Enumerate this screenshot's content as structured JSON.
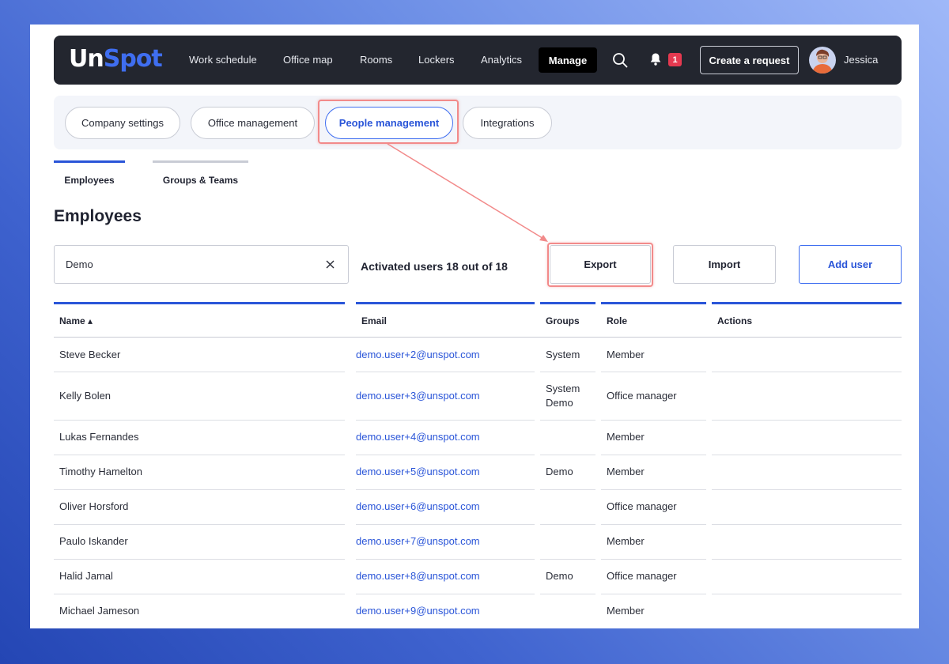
{
  "brand": {
    "logo_un": "Un",
    "logo_spot": "Spot"
  },
  "nav": {
    "links": [
      "Work schedule",
      "Office map",
      "Rooms",
      "Lockers",
      "Analytics"
    ],
    "manage": "Manage",
    "notifications_count": "1",
    "create_request": "Create a request",
    "user_name": "Jessica"
  },
  "settings_tabs": [
    "Company settings",
    "Office management",
    "People management",
    "Integrations"
  ],
  "sub_tabs": [
    "Employees",
    "Groups & Teams"
  ],
  "page_title": "Employees",
  "search": {
    "value": "Demo"
  },
  "activated_text": "Activated users 18 out of 18",
  "buttons": {
    "export": "Export",
    "import": "Import",
    "add_user": "Add user"
  },
  "table": {
    "headers": {
      "name": "Name ▴",
      "email": "Email",
      "groups": "Groups",
      "role": "Role",
      "actions": "Actions"
    },
    "rows": [
      {
        "name": "Steve Becker",
        "email": "demo.user+2@unspot.com",
        "groups": "System",
        "role": "Member"
      },
      {
        "name": "Kelly Bolen",
        "email": "demo.user+3@unspot.com",
        "groups": "System\nDemo",
        "role": "Office manager"
      },
      {
        "name": "Lukas Fernandes",
        "email": "demo.user+4@unspot.com",
        "groups": "",
        "role": "Member"
      },
      {
        "name": "Timothy Hamelton",
        "email": "demo.user+5@unspot.com",
        "groups": "Demo",
        "role": "Member"
      },
      {
        "name": "Oliver Horsford",
        "email": "demo.user+6@unspot.com",
        "groups": "",
        "role": "Office manager"
      },
      {
        "name": "Paulo Iskander",
        "email": "demo.user+7@unspot.com",
        "groups": "",
        "role": "Member"
      },
      {
        "name": "Halid Jamal",
        "email": "demo.user+8@unspot.com",
        "groups": "Demo",
        "role": "Office manager"
      },
      {
        "name": "Michael Jameson",
        "email": "demo.user+9@unspot.com",
        "groups": "",
        "role": "Member"
      }
    ]
  },
  "colors": {
    "accent": "#2a55d8",
    "nav_bg": "#23262f",
    "highlight": "#f28a8a",
    "badge": "#e53950"
  }
}
